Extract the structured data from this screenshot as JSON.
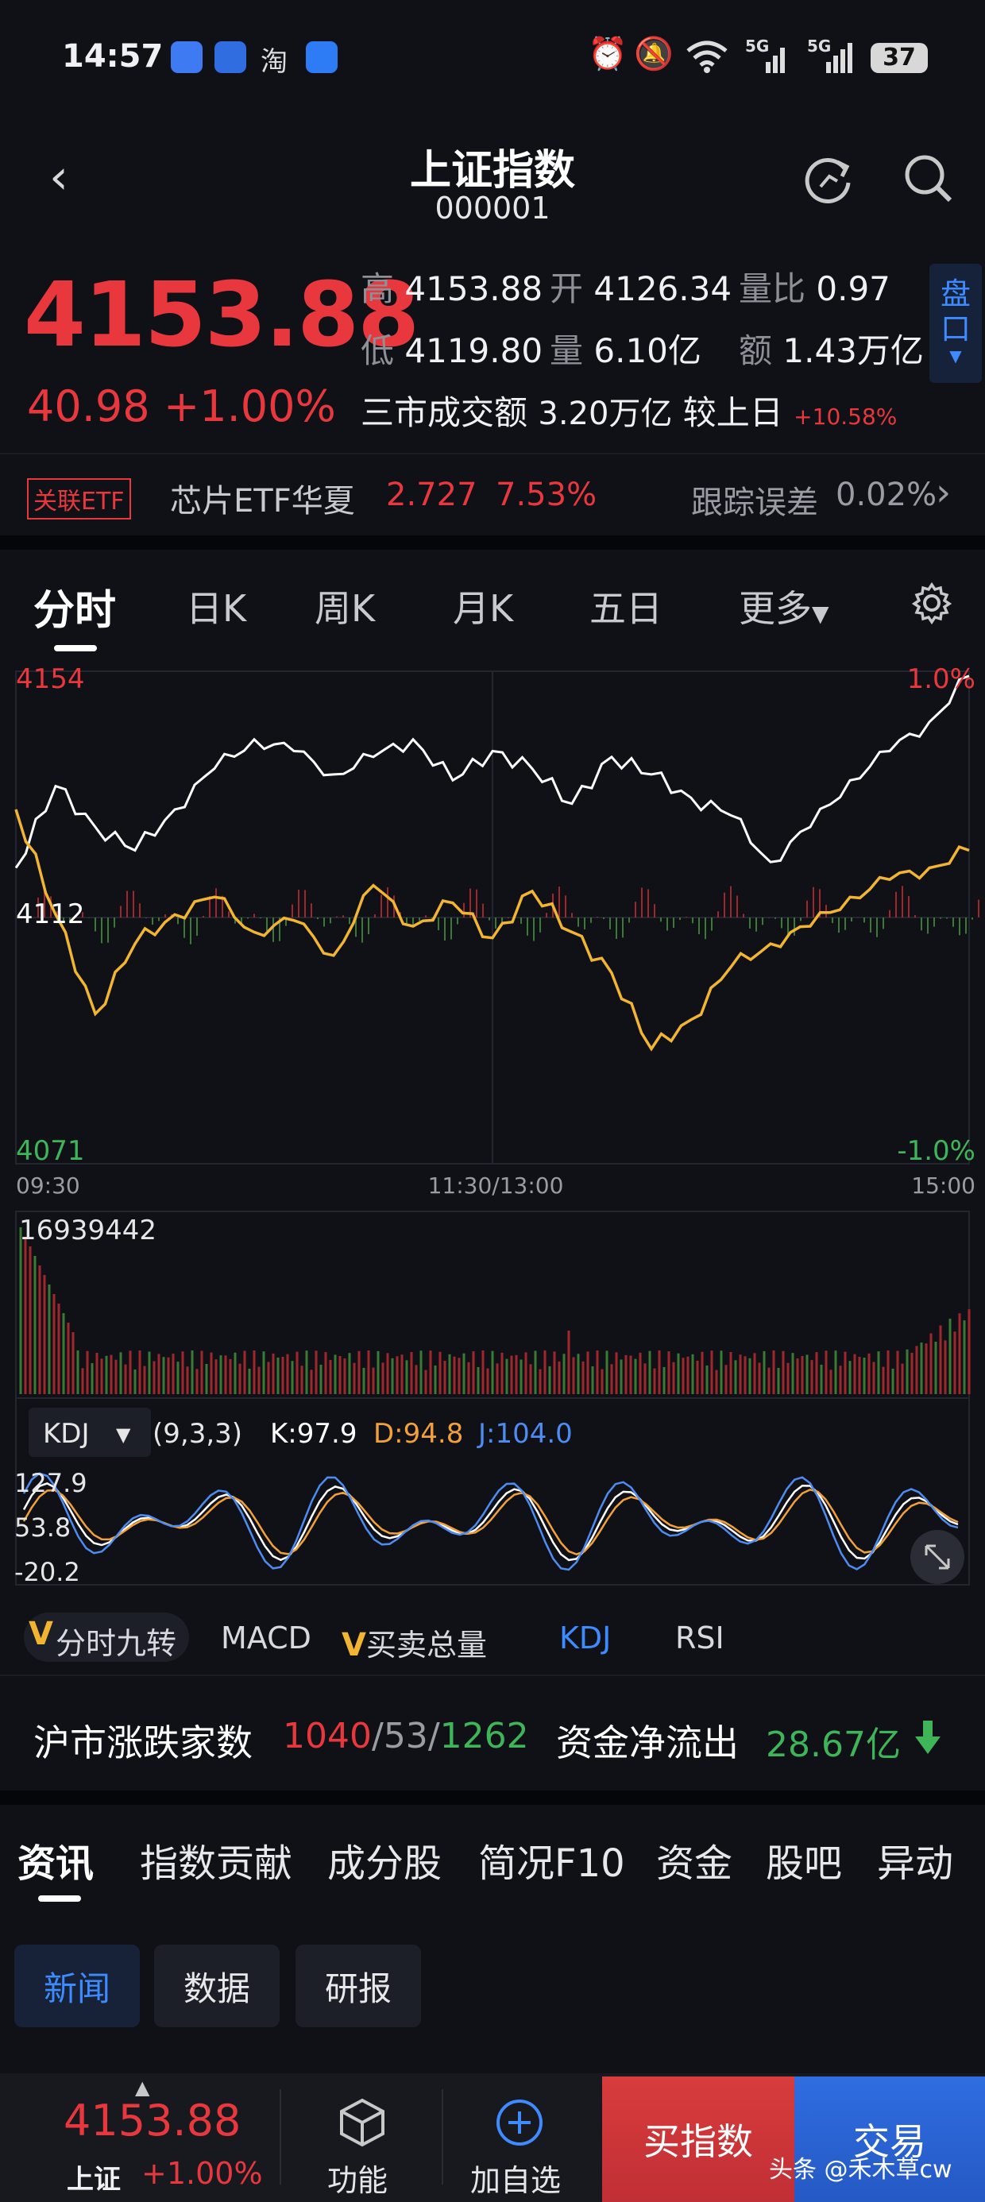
{
  "status_bar": {
    "time": "14:57",
    "battery": "37",
    "signal1": "5G",
    "signal2": "5G",
    "app_taobao": "淘"
  },
  "header": {
    "title": "上证指数",
    "code": "000001"
  },
  "quote": {
    "price": "4153.88",
    "change": "40.98",
    "change_pct": "+1.00%",
    "high_label": "高",
    "high": "4153.88",
    "open_label": "开",
    "open": "4126.34",
    "ratio_label": "量比",
    "ratio": "0.97",
    "low_label": "低",
    "low": "4119.80",
    "volume_label": "量",
    "volume": "6.10亿",
    "amount_label": "额",
    "amount": "1.43万亿",
    "market_label": "三市成交额",
    "market_value": "3.20万亿",
    "vs_label": "较上日",
    "vs_value": "+10.58%",
    "panel_button": "盘口"
  },
  "etf": {
    "tag": "关联ETF",
    "name": "芯片ETF华夏",
    "price": "2.727",
    "pct": "7.53%",
    "track_label": "跟踪误差",
    "track_value": "0.02%"
  },
  "period_tabs": [
    "分时",
    "日K",
    "周K",
    "月K",
    "五日",
    "更多"
  ],
  "chart_data": {
    "type": "line",
    "title": "",
    "y_ticks": {
      "top": "4154",
      "mid": "4112",
      "bottom": "4071"
    },
    "pct_ticks": {
      "top": "1.0%",
      "bottom": "-1.0%"
    },
    "x_ticks": [
      "09:30",
      "11:30/13:00",
      "15:00"
    ],
    "ylim": [
      4071,
      4154
    ],
    "x": [
      0,
      10,
      20,
      30,
      40,
      50,
      60,
      70,
      80,
      90,
      100,
      110,
      120,
      130,
      140,
      150,
      160,
      170,
      180,
      190,
      200,
      210,
      220,
      230,
      240
    ],
    "series": [
      {
        "values": [
          4121,
          4135,
          4128,
          4124,
          4131,
          4138,
          4143,
          4141,
          4137,
          4140,
          4143,
          4136,
          4141,
          4138,
          4132,
          4140,
          4137,
          4133,
          4130,
          4122,
          4128,
          4136,
          4141,
          4146,
          4153.88
        ]
      },
      {
        "values": [
          4131,
          4113,
          4096,
          4108,
          4113,
          4116,
          4110,
          4112,
          4106,
          4118,
          4111,
          4115,
          4109,
          4117,
          4110,
          4103,
          4090,
          4095,
          4104,
          4108,
          4111,
          4116,
          4119,
          4121,
          4124
        ]
      }
    ],
    "volume_label": "16939442",
    "kdj": {
      "selector": "KDJ",
      "params": "(9,3,3)",
      "k": "K:97.9",
      "d": "D:94.8",
      "j": "J:104.0",
      "ticks": [
        "127.9",
        "53.8",
        "-20.2"
      ]
    }
  },
  "indicator_tabs": {
    "t1": "分时九转",
    "t2": "MACD",
    "t3": "买卖总量",
    "t4": "KDJ",
    "t5": "RSI",
    "v_mark": "V"
  },
  "breadth": {
    "label": "沪市涨跌家数",
    "up": "1040",
    "flat": "53",
    "down": "1262",
    "sep": "/",
    "flow_label": "资金净流出",
    "flow_value": "28.67亿"
  },
  "section_tabs": [
    "资讯",
    "指数贡献",
    "成分股",
    "简况F10",
    "资金",
    "股吧",
    "异动"
  ],
  "news_chips": [
    "新闻",
    "数据",
    "研报"
  ],
  "bottom": {
    "price": "4153.88",
    "name": "上证",
    "pct": "+1.00%",
    "func": "功能",
    "add": "加自选",
    "buy": "买指数",
    "trade": "交易",
    "watermark": "头条 @禾木草cw"
  },
  "colors": {
    "up": "#e8383d",
    "down": "#3fb55a",
    "accent": "#3d8bff",
    "avg_line": "#f2b531",
    "bg": "#0f1117"
  }
}
